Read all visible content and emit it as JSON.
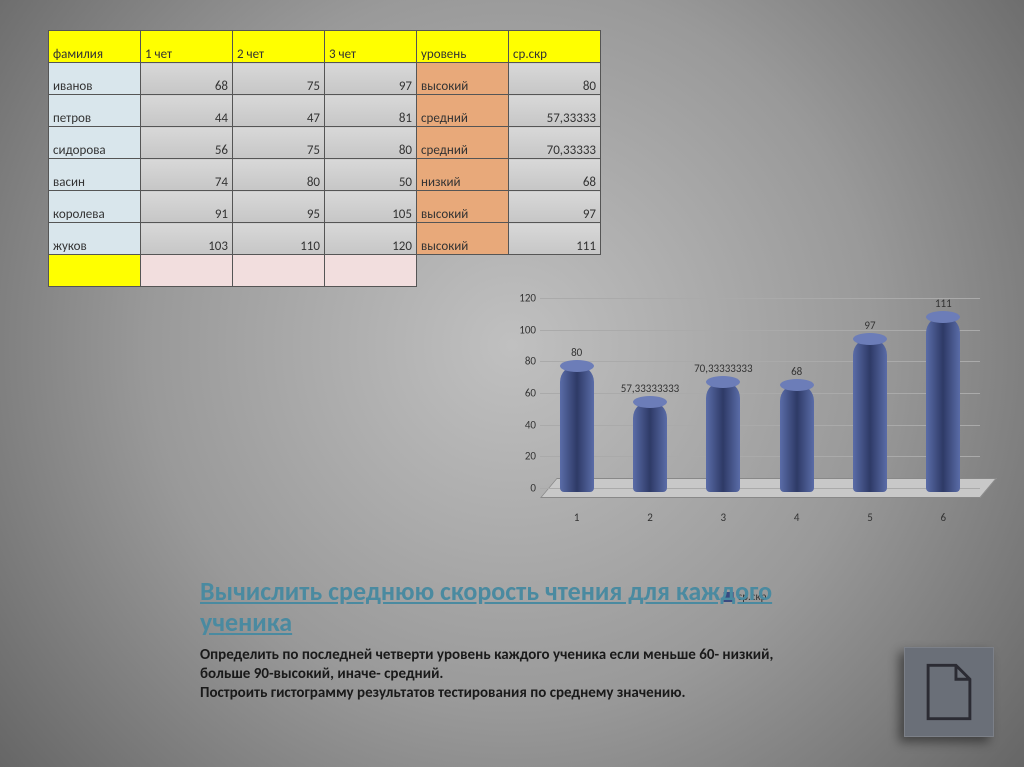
{
  "table": {
    "headers": [
      "фамилия",
      "1 чет",
      "2 чет",
      "3 чет",
      "уровень",
      "ср.скр"
    ],
    "rows": [
      {
        "name": "иванов",
        "c1": "68",
        "c2": "75",
        "c3": "97",
        "lvl": "высокий",
        "avg": "80"
      },
      {
        "name": "петров",
        "c1": "44",
        "c2": "47",
        "c3": "81",
        "lvl": "средний",
        "avg": "57,33333"
      },
      {
        "name": "сидорова",
        "c1": "56",
        "c2": "75",
        "c3": "80",
        "lvl": "средний",
        "avg": "70,33333"
      },
      {
        "name": "васин",
        "c1": "74",
        "c2": "80",
        "c3": "50",
        "lvl": "низкий",
        "avg": "68"
      },
      {
        "name": "королева",
        "c1": "91",
        "c2": "95",
        "c3": "105",
        "lvl": "высокий",
        "avg": "97"
      },
      {
        "name": "жуков",
        "c1": "103",
        "c2": "110",
        "c3": "120",
        "lvl": "высокий",
        "avg": "111"
      }
    ]
  },
  "chart_data": {
    "type": "bar",
    "categories": [
      "1",
      "2",
      "3",
      "4",
      "5",
      "6"
    ],
    "values": [
      80,
      57.33333333,
      70.33333333,
      68,
      97,
      111
    ],
    "labels": [
      "80",
      "57,33333333",
      "70,33333333",
      "68",
      "97",
      "111"
    ],
    "series_name": "ср.скр",
    "ylim": [
      0,
      120
    ],
    "yticks": [
      0,
      20,
      40,
      60,
      80,
      100,
      120
    ]
  },
  "heading": " Вычислить среднюю скорость чтения для каждого ученика",
  "body": "Определить по последней четверти уровень каждого ученика если меньше 60- низкий, больше 90-высокий, иначе- средний.\nПостроить гистограмму результатов тестирования по среднему значению."
}
